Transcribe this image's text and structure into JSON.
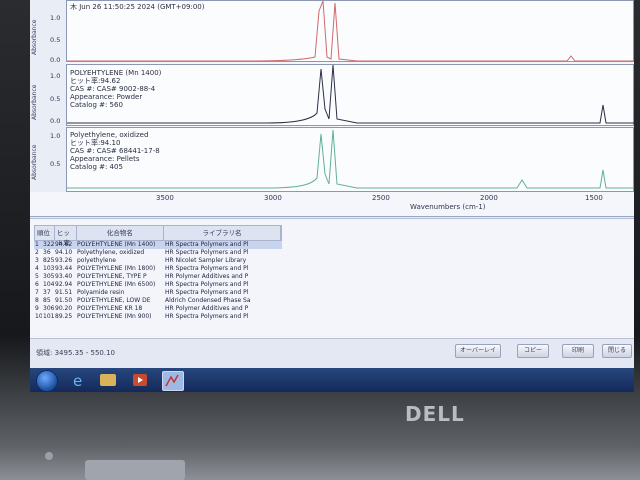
{
  "window": {
    "timestamp": "木 Jun 26 11:50:25 2024 (GMT+09:00)"
  },
  "spectra": {
    "panels": [
      {
        "id": "panel-1",
        "ylabel": "Absorbance",
        "yticks": [
          "1.0",
          "0.5",
          "0.0"
        ],
        "meta_lines": [
          "木 Jun 26 11:50:25 2024 (GMT+09:00)"
        ],
        "line_color": "#d06a6a"
      },
      {
        "id": "panel-2",
        "ylabel": "Absorbance",
        "yticks": [
          "1.0",
          "0.5",
          "0.0"
        ],
        "meta_lines": [
          "POLYEHTYLENE (Mn 1400)",
          "ヒット率:94.62",
          "CAS #:   CAS# 9002-88-4",
          "Appearance:   Powder",
          "Catalog #:   560"
        ],
        "line_color": "#2a2f44"
      },
      {
        "id": "panel-3",
        "ylabel": "Absorbance",
        "yticks": [
          "1.0",
          "0.5"
        ],
        "meta_lines": [
          "Polyethylene, oxidized",
          "ヒット率:94.10",
          "CAS #:   CAS# 68441-17-8",
          "Appearance:   Pellets",
          "Catalog #:   405"
        ],
        "line_color": "#5fb09a"
      }
    ],
    "xticks": [
      "3500",
      "3000",
      "2500",
      "2000",
      "1500"
    ],
    "xlabel": "Wavenumbers (cm-1)"
  },
  "results_table": {
    "headers": [
      "順位",
      "ヒット率",
      "化合物名",
      "ライブラリ名"
    ],
    "rows": [
      [
        "1",
        "322",
        "94.62",
        "POLYEHTYLENE (Mn 1400)",
        "HR Spectra Polymers and Pl"
      ],
      [
        "2",
        "36",
        "94.10",
        "Polyethylene, oxidized",
        "HR Spectra Polymers and Pl"
      ],
      [
        "3",
        "825",
        "93.26",
        "polyethylene",
        "HR Nicolet Sampler Library"
      ],
      [
        "4",
        "103",
        "93.44",
        "POLYETHYLENE (Mn 1800)",
        "HR Spectra Polymers and Pl"
      ],
      [
        "5",
        "305",
        "93.40",
        "POLYETHYLENE, TYPE P",
        "HR Polymer Additives and P"
      ],
      [
        "6",
        "104",
        "92.94",
        "POLYETHYLENE (Mn 6500)",
        "HR Spectra Polymers and Pl"
      ],
      [
        "7",
        "37",
        "91.51",
        "Polyamide resin",
        "HR Spectra Polymers and Pl"
      ],
      [
        "8",
        "85",
        "91.50",
        "POLYETHYLENE, LOW DE",
        "Aldrich Condensed Phase Sa"
      ],
      [
        "9",
        "306",
        "90.20",
        "POLYETHYLENE KR 18",
        "HR Polymer Additives and P"
      ],
      [
        "10",
        "101",
        "89.25",
        "POLYETHYLENE (Mn 900)",
        "HR Spectra Polymers and Pl"
      ]
    ]
  },
  "status": {
    "text": "領域:  3495.35  -  550.10",
    "buttons": [
      "オーバーレイ",
      "コピー",
      "印刷",
      "閉じる"
    ]
  },
  "taskbar": {
    "items": [
      "start-orb",
      "internet-explorer-icon",
      "file-explorer-icon",
      "media-player-icon",
      "omnic-app-icon"
    ]
  },
  "device": {
    "brand": "DELL"
  }
}
